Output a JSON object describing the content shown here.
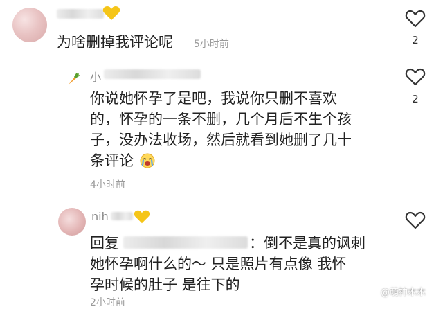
{
  "comments": [
    {
      "text": "为啥删掉我评论呢",
      "time": "5小时前",
      "like_count": "2"
    },
    {
      "username": "小",
      "text_lines": [
        "你说她怀孕了是吧，我说你只删不喜欢",
        "的，怀孕的一条不删，几个月后不生个孩",
        "子，没办法收场，然后就看到她删了几十",
        "条评论"
      ],
      "time": "4小时前",
      "like_count": "2"
    },
    {
      "username": "nih",
      "reply_prefix": "回复",
      "reply_rest": "：倒不是真的讽刺",
      "text_lines": [
        "她怀孕啊什么的～ 只是照片有点像 我怀",
        "孕时候的肚子 是往下的"
      ],
      "time": "2小时前"
    }
  ],
  "watermark": "@萌神木木",
  "colors": {
    "heart_stroke": "#333333",
    "muted": "#999999",
    "text": "#222222",
    "emoji_yellow": "#f5c518"
  },
  "icons": [
    "heart-outline-icon",
    "carrot-icon",
    "yellow-heart-icon",
    "crying-emoji-icon"
  ]
}
